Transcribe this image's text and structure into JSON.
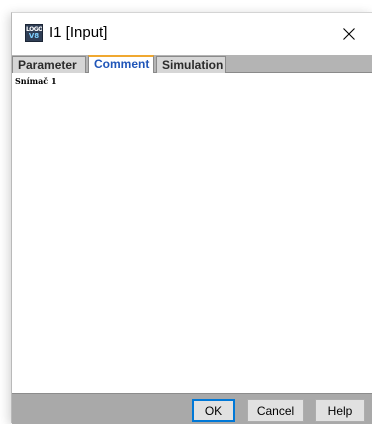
{
  "window": {
    "title": "I1 [Input]",
    "app_icon": {
      "name": "logo-app-icon",
      "line1": "LOGO",
      "line2": "V8"
    }
  },
  "tabs": [
    {
      "label": "Parameter",
      "active": false
    },
    {
      "label": "Comment",
      "active": true
    },
    {
      "label": "Simulation",
      "active": false
    }
  ],
  "comment": {
    "text": "Snímač 1"
  },
  "buttons": {
    "ok": "OK",
    "cancel": "Cancel",
    "help": "Help"
  },
  "colors": {
    "active_tab_text": "#1f55b8",
    "active_tab_accent": "#f0a830",
    "default_button_border": "#0078d7",
    "footer_bg": "#a9a9a9"
  }
}
